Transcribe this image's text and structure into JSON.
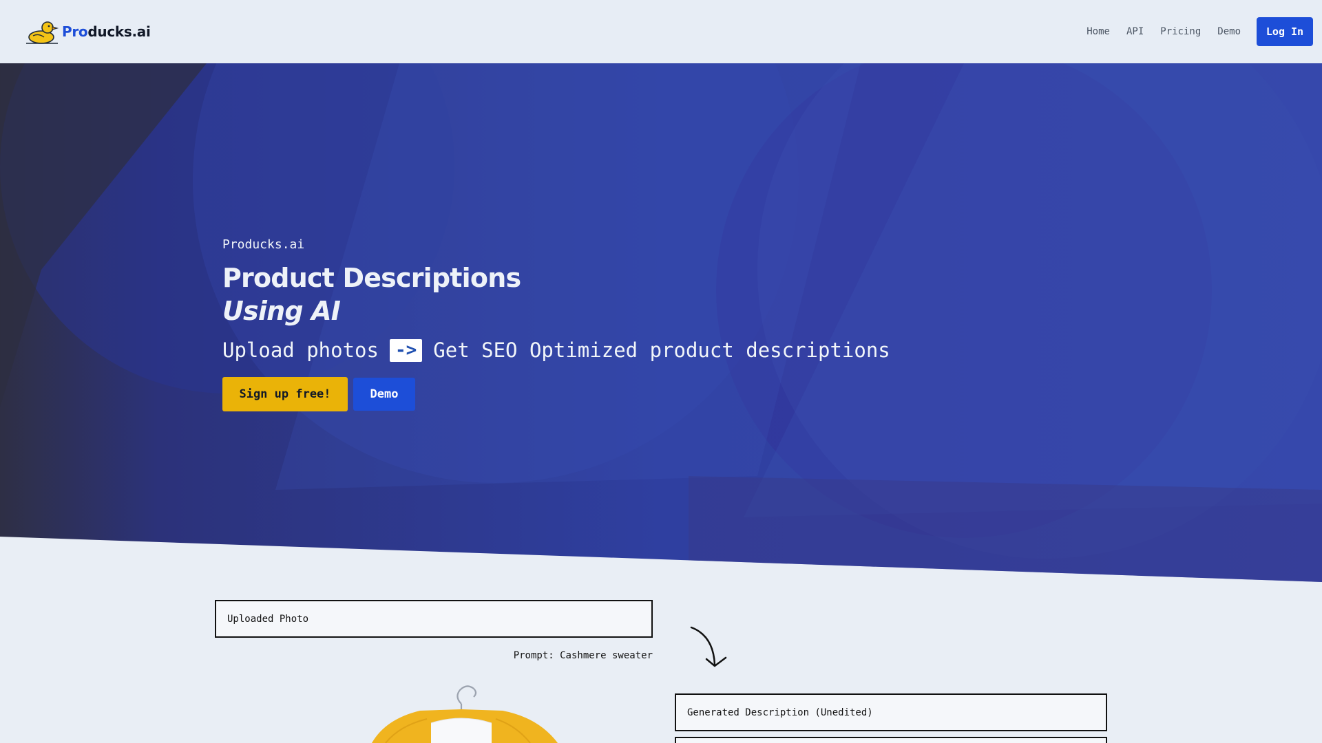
{
  "nav": {
    "brand_prefix": "Pro",
    "brand_suffix": "ducks.ai",
    "links": [
      "Home",
      "API",
      "Pricing",
      "Demo"
    ],
    "login_label": "Log In"
  },
  "hero": {
    "eyebrow": "Producks.ai",
    "title_line1": "Product Descriptions",
    "title_line2": "Using AI",
    "sub_before": "Upload photos",
    "sub_arrow": "->",
    "sub_after": "Get SEO Optimized product descriptions",
    "signup_label": "Sign up free!",
    "demo_label": "Demo"
  },
  "demo": {
    "uploaded_title": "Uploaded Photo",
    "prompt": "Prompt: Cashmere sweater",
    "generated_title": "Generated Description (Unedited)"
  },
  "colors": {
    "accent_blue": "#1d4ed8",
    "accent_yellow": "#eab308",
    "hero_blue": "#2f3ea0"
  }
}
